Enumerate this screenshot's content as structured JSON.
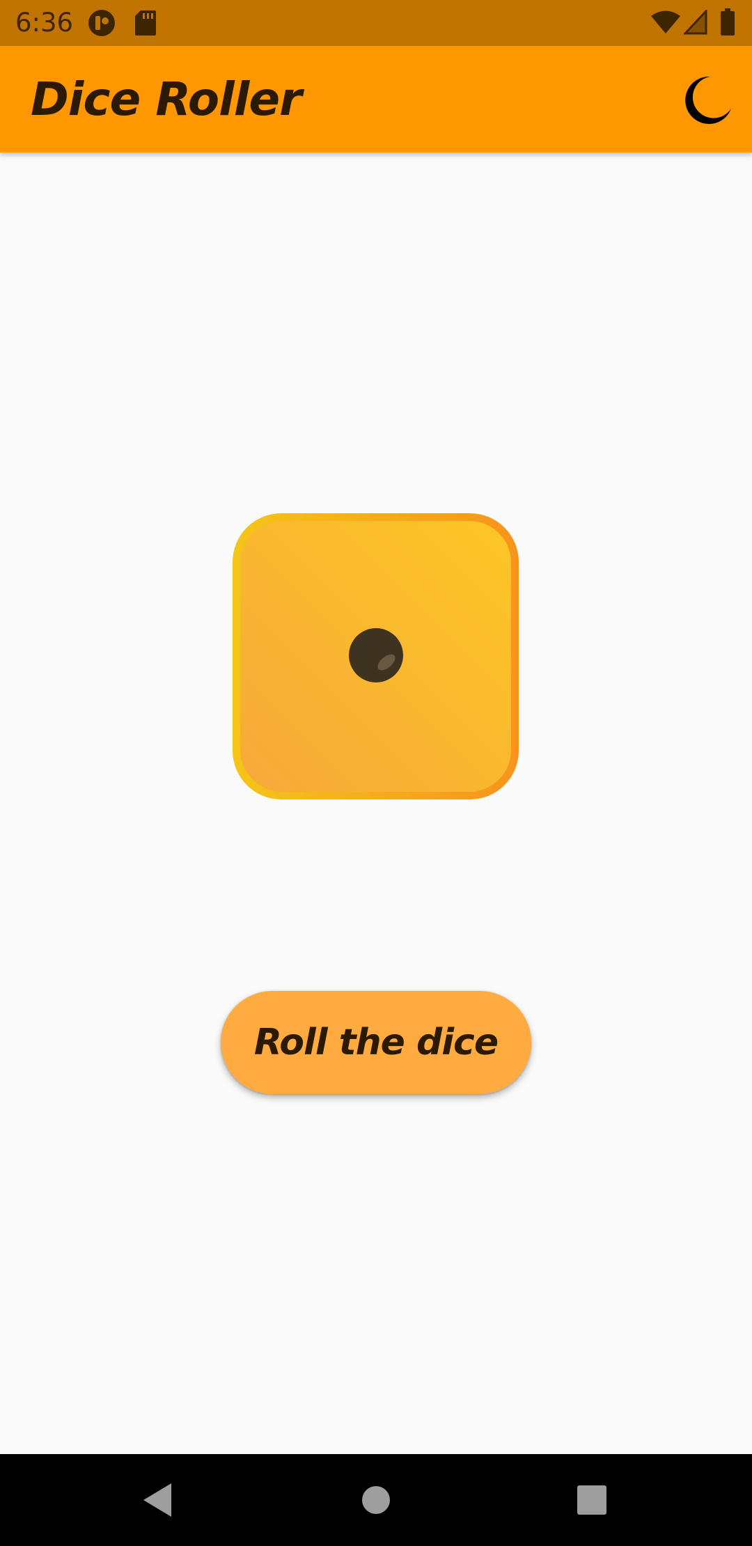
{
  "status_bar": {
    "time": "6:36",
    "left_icons": [
      "notification-app-icon",
      "sd-card-icon"
    ],
    "right_icons": [
      "wifi-icon",
      "cell-signal-icon",
      "battery-icon"
    ]
  },
  "app_bar": {
    "title": "Dice Roller",
    "theme_toggle_icon": "moon-icon"
  },
  "die": {
    "value": 1,
    "colors": {
      "face_light": "#fcc624",
      "face_dark": "#f7a93b",
      "border_left": "#f5c518",
      "border_right": "#f7951d",
      "pip": "#3e3320"
    }
  },
  "roll_button": {
    "label": "Roll the dice"
  },
  "navigation_bar": {
    "buttons": [
      "back-icon",
      "home-icon",
      "recents-icon"
    ]
  },
  "colors": {
    "status_bar": "#c17400",
    "app_bar": "#ff9800",
    "background": "#fafafa",
    "button": "#ffab40",
    "text_dark": "#2b1a00"
  }
}
